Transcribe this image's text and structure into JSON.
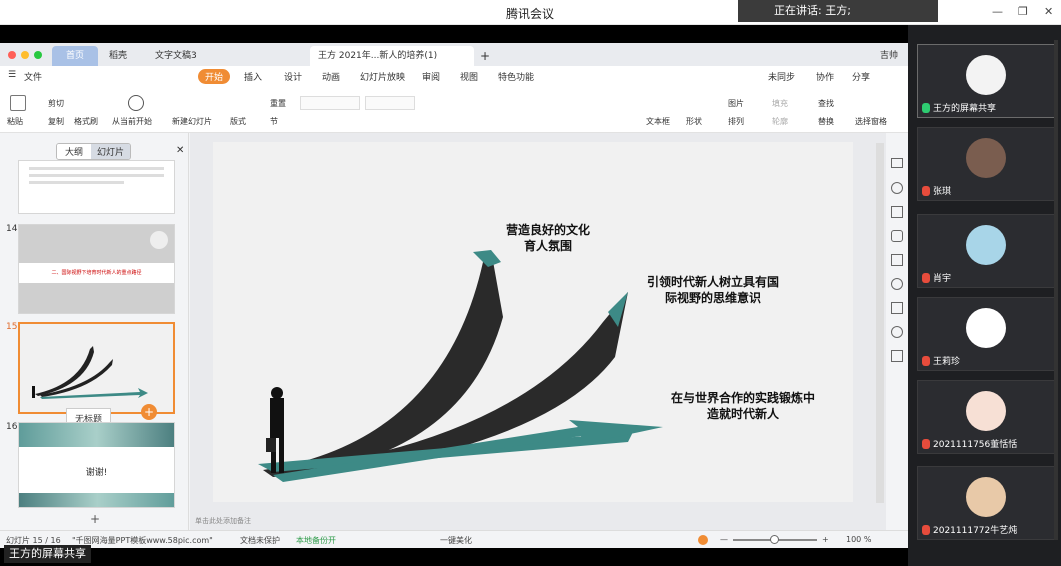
{
  "window": {
    "title": "腾讯会议",
    "speaking": "正在讲话: 王方;"
  },
  "wps": {
    "tabs": [
      "首页",
      "稻壳",
      "文字文稿3",
      "王方 2021年...新人的培养(1)"
    ],
    "user": "吉帅",
    "menu": [
      "文件",
      "开始",
      "插入",
      "设计",
      "动画",
      "幻灯片放映",
      "审阅",
      "视图",
      "特色功能"
    ],
    "menu_right": [
      "未同步",
      "协作",
      "分享"
    ],
    "ribbon": {
      "paste": "粘贴",
      "cut": "剪切",
      "copy": "复制",
      "format": "格式刷",
      "play": "从当前开始",
      "new_slide": "新建幻灯片",
      "layout": "版式",
      "section": "节",
      "reset": "重置",
      "textbox": "文本框",
      "shape": "形状",
      "picture": "图片",
      "arrange": "排列",
      "fill": "填充",
      "outline": "轮廓",
      "find": "查找",
      "replace": "替换",
      "select": "选择窗格"
    },
    "panel_tabs": [
      "大纲",
      "幻灯片"
    ],
    "slides": [
      {
        "num": "14",
        "text": "二、国际视野下培育时代新人的重点路径"
      },
      {
        "num": "15",
        "tooltip": "无标题"
      },
      {
        "num": "16",
        "text": "谢谢!"
      }
    ],
    "slide": {
      "text1": "营造良好的文化\n育人氛围",
      "text2": "引领时代新人树立具有国\n际视野的思维意识",
      "text3": "在与世界合作的实践锻炼中\n造就时代新人"
    },
    "notes_placeholder": "单击此处添加备注",
    "status": {
      "slide_count": "幻灯片 15 / 16",
      "template": "\"千图网海量PPT模板www.58pic.com\"",
      "protect": "文档未保护",
      "backup": "本地备份开",
      "beautify": "一键美化",
      "zoom": "100 %"
    }
  },
  "participants": [
    {
      "name": "王方的屏幕共享"
    },
    {
      "name": "张琪"
    },
    {
      "name": "肖宇"
    },
    {
      "name": "王莉珍"
    },
    {
      "name": "2021111756董恬恬"
    },
    {
      "name": "2021111772牛艺炖"
    }
  ],
  "share_label": "王方的屏幕共享"
}
